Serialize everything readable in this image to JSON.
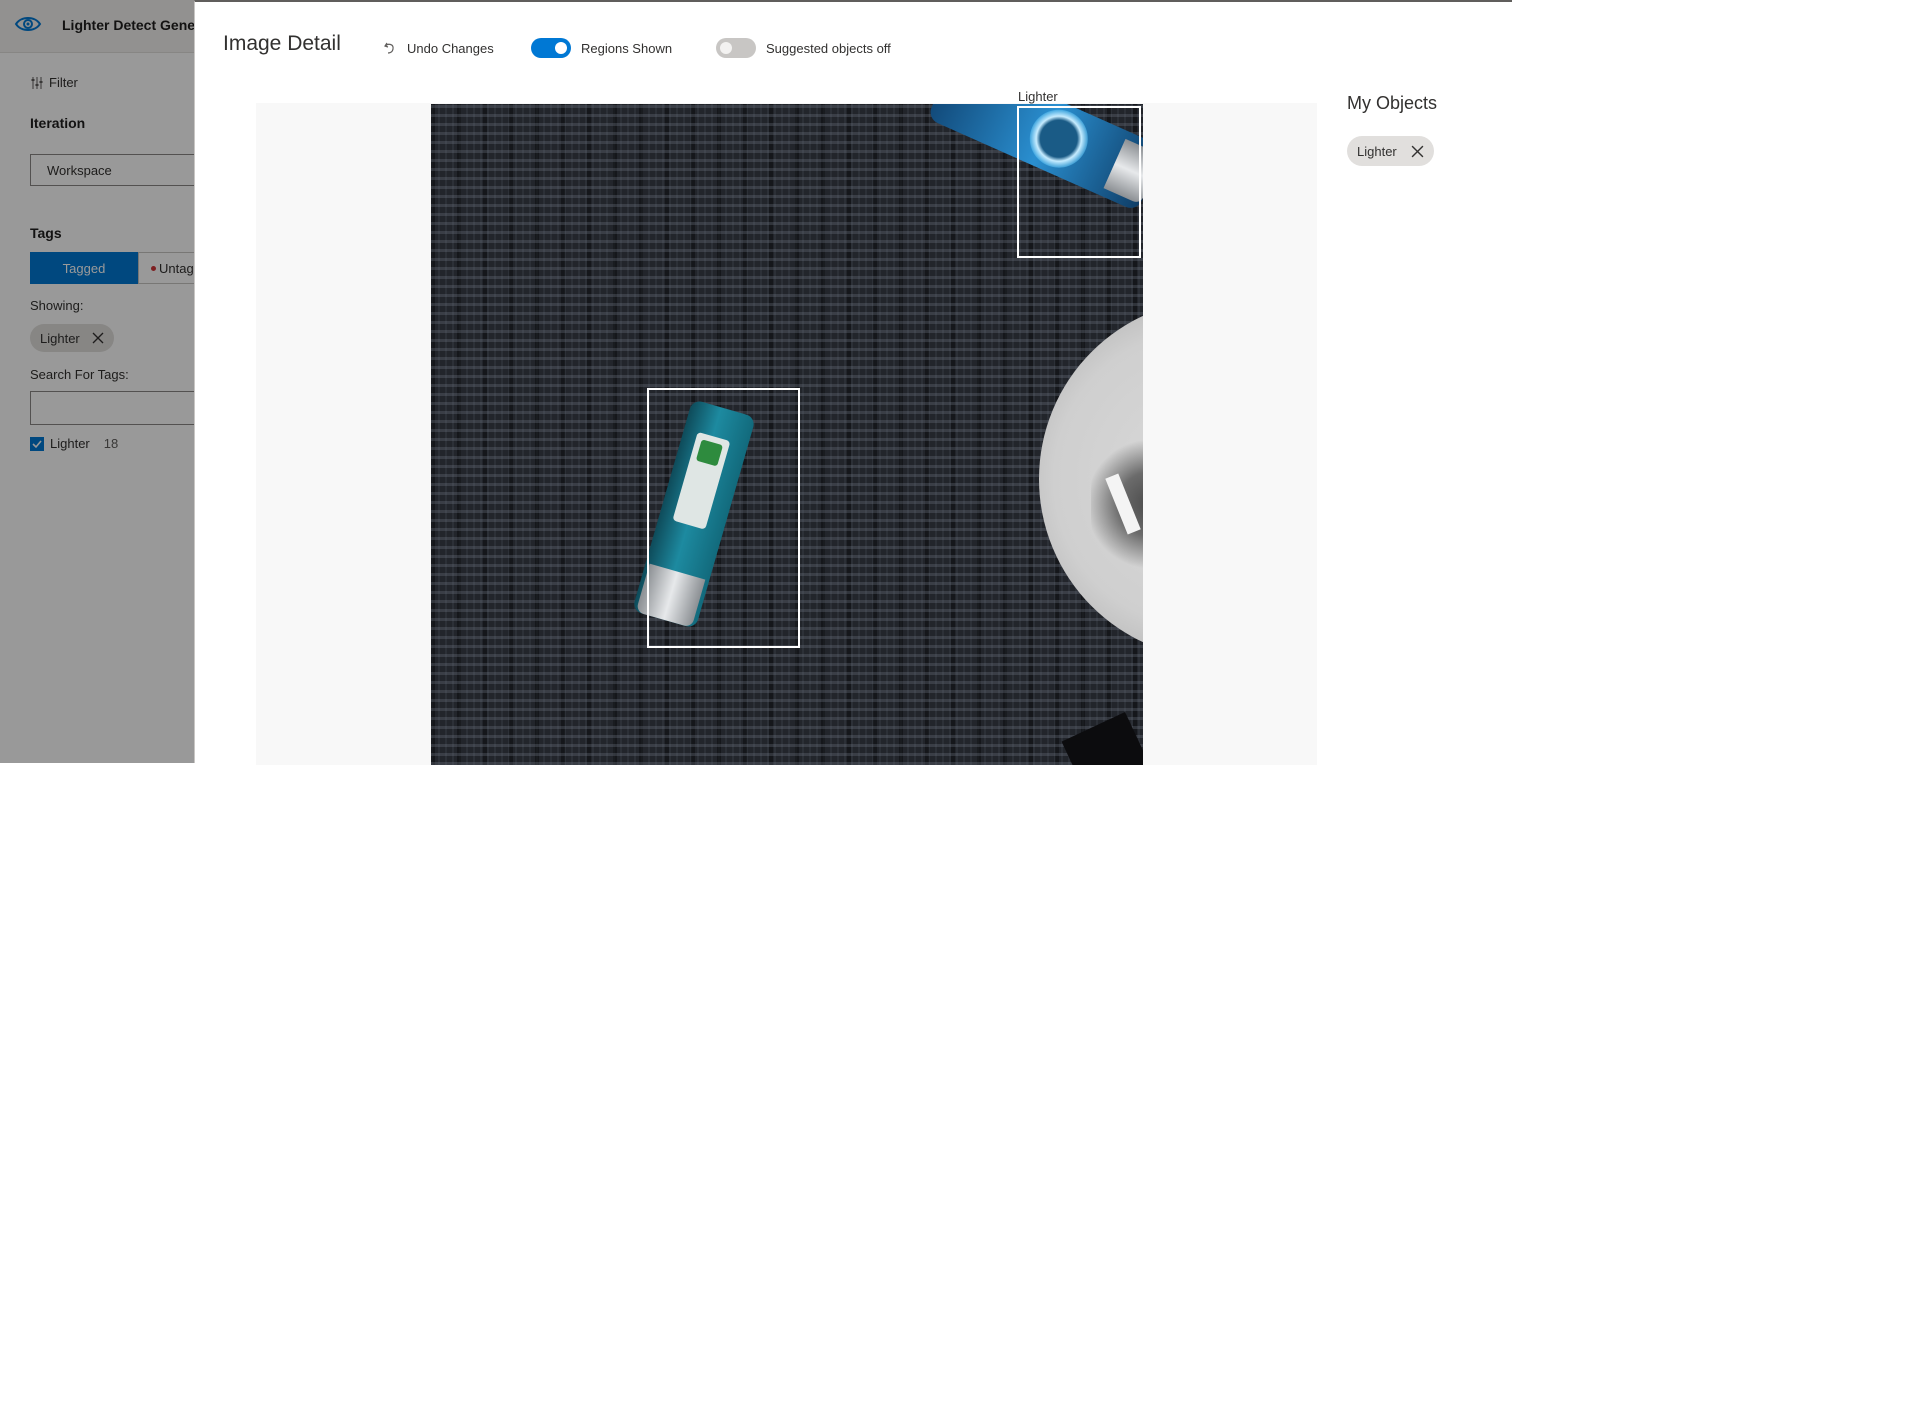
{
  "app": {
    "title": "Lighter Detect Gener",
    "sidebar": {
      "filter_label": "Filter",
      "iteration_heading": "Iteration",
      "iteration_value": "Workspace",
      "tags_heading": "Tags",
      "tagged_label": "Tagged",
      "untagged_label": "Untag",
      "showing_label": "Showing:",
      "showing_chip": "Lighter",
      "search_label": "Search For Tags:",
      "search_value": "",
      "tag_list": [
        {
          "name": "Lighter",
          "count": "18",
          "checked": true
        }
      ]
    }
  },
  "panel": {
    "title": "Image Detail",
    "toolbar": {
      "undo_label": "Undo Changes",
      "regions_label": "Regions Shown",
      "regions_on": true,
      "suggested_label": "Suggested objects off",
      "suggested_on": false
    },
    "regions": [
      {
        "label": "Lighter",
        "label_visible": true
      },
      {
        "label": "Lighter",
        "label_visible": false
      }
    ],
    "my_objects": {
      "heading": "My Objects",
      "items": [
        "Lighter"
      ]
    }
  },
  "colors": {
    "accent": "#0078d4",
    "untagged_dot": "#d13438",
    "region_border": "#ffffff"
  },
  "icons": {
    "logo": "eye-icon",
    "filter": "sliders-icon",
    "undo": "undo-icon",
    "remove": "close-icon",
    "check": "checkmark-icon"
  }
}
